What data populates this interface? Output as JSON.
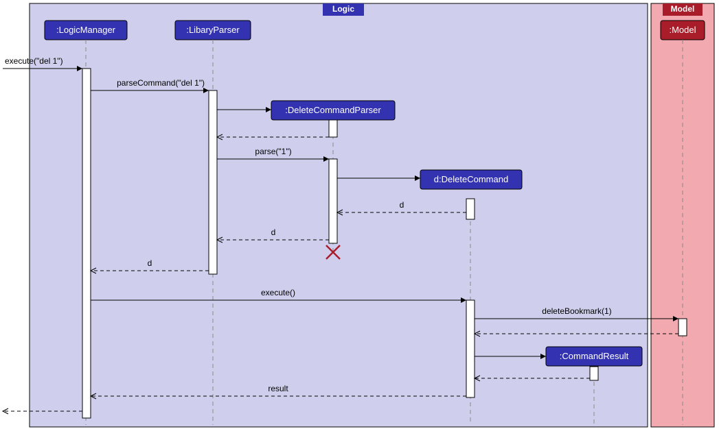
{
  "frames": {
    "logic": {
      "label": "Logic"
    },
    "model": {
      "label": "Model"
    }
  },
  "participants": {
    "logicManager": ":LogicManager",
    "libaryParser": ":LibaryParser",
    "deleteCommandParser": ":DeleteCommandParser",
    "deleteCommand": "d:DeleteCommand",
    "commandResult": ":CommandResult",
    "model": ":Model"
  },
  "messages": {
    "execute": "execute(\"del 1\")",
    "parseCommand": "parseCommand(\"del 1\")",
    "parse": "parse(\"1\")",
    "d1": "d",
    "d2": "d",
    "d3": "d",
    "execute2": "execute()",
    "deleteBookmark": "deleteBookmark(1)",
    "result": "result"
  }
}
